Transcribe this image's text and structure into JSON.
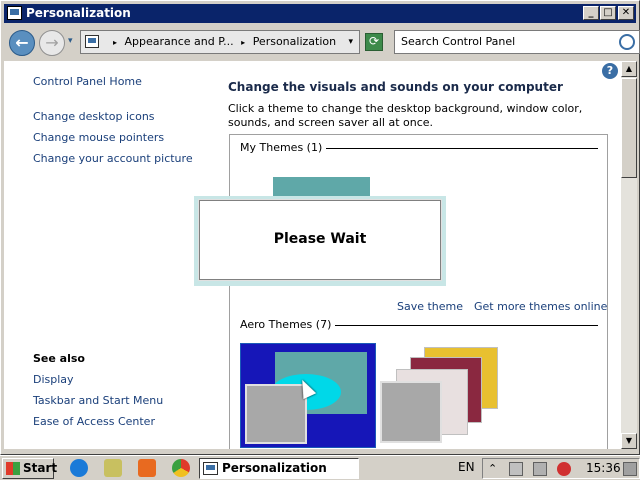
{
  "window": {
    "title": "Personalization",
    "controls": {
      "minimize": "_",
      "maximize": "□",
      "close": "✕"
    }
  },
  "navbar": {
    "back": "←",
    "forward": "→",
    "breadcrumb": [
      "Appearance and P...",
      "Personalization"
    ],
    "search_placeholder": "Search Control Panel"
  },
  "left": {
    "home": "Control Panel Home",
    "links": [
      "Change desktop icons",
      "Change mouse pointers",
      "Change your account picture"
    ],
    "see_also_title": "See also",
    "see_also": [
      "Display",
      "Taskbar and Start Menu",
      "Ease of Access Center"
    ]
  },
  "main": {
    "heading": "Change the visuals and sounds on your computer",
    "description": "Click a theme to change the desktop background, window color, sounds, and screen saver all at once.",
    "my_themes": "My Themes (1)",
    "save_theme": "Save theme",
    "get_more": "Get more themes online",
    "aero_themes": "Aero Themes (7)"
  },
  "dialog": {
    "message": "Please Wait"
  },
  "taskbar": {
    "start": "Start",
    "active_task": "Personalization",
    "language": "EN",
    "clock": "15:36"
  },
  "icons": {
    "help": "?",
    "chevron": "▸",
    "dropdown": "▾"
  },
  "colors": {
    "title_bar": "#0a246a",
    "link": "#1a3f7a",
    "aero_bg": "#1616b8",
    "teal": "#5fa8a8"
  }
}
